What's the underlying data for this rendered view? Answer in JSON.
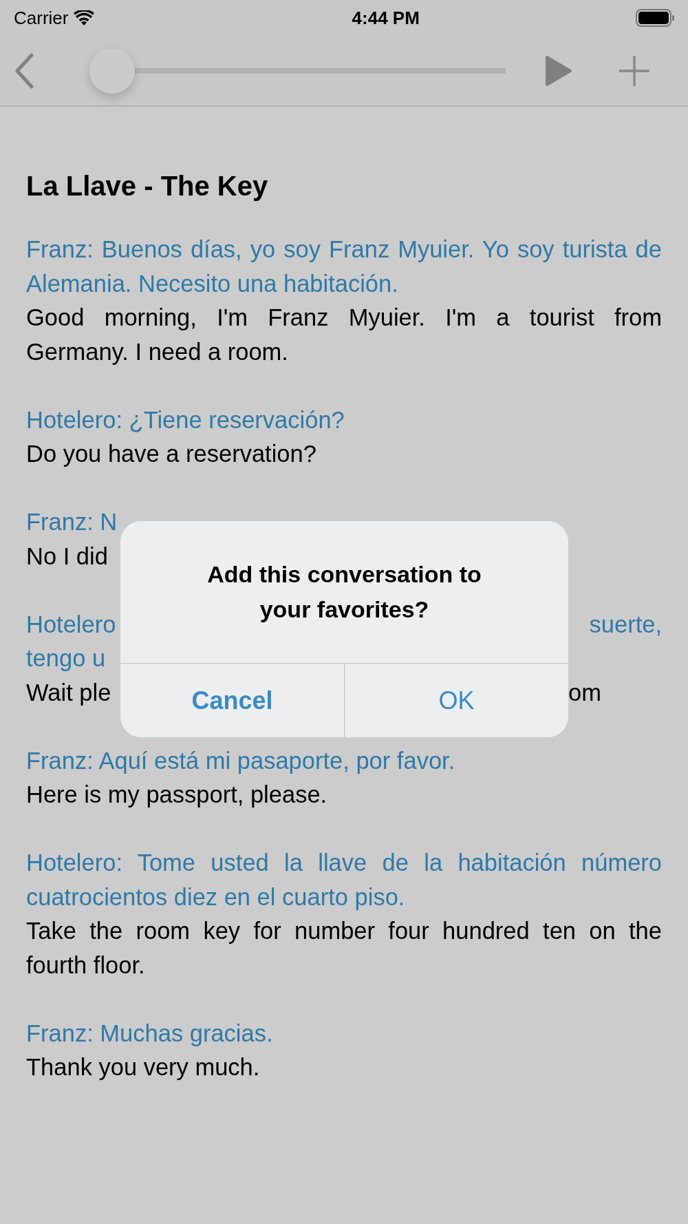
{
  "status_bar": {
    "carrier": "Carrier",
    "time": "4:44 PM"
  },
  "toolbar": {
    "slider": {
      "level": 0
    }
  },
  "title": "La Llave - The Key",
  "dialogue": [
    {
      "kind": "full",
      "spanish": "Franz: Buenos días, yo soy Franz Myuier. Yo soy turista de Alemania. Necesito una habitación.",
      "english": "Good morning, I'm Franz Myuier. I'm a tourist from Germany. I need a room."
    },
    {
      "kind": "full",
      "spanish": "Hotelero: ¿Tiene reservación?",
      "english": "Do you have a reservation?"
    },
    {
      "kind": "obscured",
      "lines": [
        {
          "kind": "spanish",
          "left": "Franz: N"
        },
        {
          "kind": "english",
          "left": "No I did"
        }
      ]
    },
    {
      "kind": "obscured",
      "lines": [
        {
          "kind": "spanish",
          "left": "Hotelero",
          "right": "suerte,"
        },
        {
          "kind": "spanish",
          "left": "tengo u"
        },
        {
          "kind": "english",
          "left": "Wait ple",
          "right": "om"
        }
      ]
    },
    {
      "kind": "full",
      "spanish": "Franz: Aquí está mi pasaporte, por favor.",
      "english": "Here is my passport, please."
    },
    {
      "kind": "full",
      "spanish": "Hotelero: Tome usted la llave de la habitación número cuatrocientos diez en el cuarto piso.",
      "english": "Take the room key for number four hundred ten on the fourth floor."
    },
    {
      "kind": "full",
      "spanish": "Franz: Muchas gracias.",
      "english": "Thank you very much."
    }
  ],
  "alert": {
    "message": "Add this conversation to your favorites?",
    "buttons": [
      {
        "label": "Cancel",
        "kind": "cancel"
      },
      {
        "label": "OK",
        "kind": "default"
      }
    ]
  }
}
